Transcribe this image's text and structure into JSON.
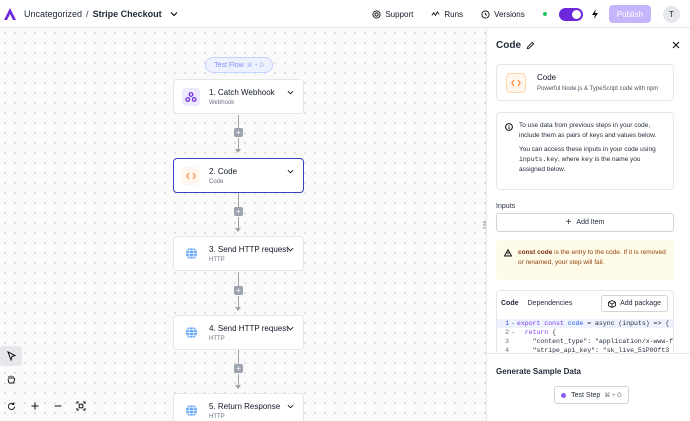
{
  "header": {
    "breadcrumb_folder": "Uncategorized",
    "breadcrumb_sep": "/",
    "flow_name": "Stripe Checkout",
    "support": "Support",
    "runs": "Runs",
    "versions": "Versions",
    "publish": "Publish",
    "avatar_initial": "T",
    "colors": {
      "accent": "#6d28d9",
      "publish_bg": "#c4b5fd",
      "status": "#22c55e"
    }
  },
  "canvas": {
    "test_flow": "Test Flow",
    "test_flow_kbd": "⌘ + D",
    "nodes": [
      {
        "title": "1. Catch Webhook",
        "subtitle": "Webhook",
        "icon": "webhook-icon"
      },
      {
        "title": "2. Code",
        "subtitle": "Code",
        "icon": "code-icon"
      },
      {
        "title": "3. Send HTTP request",
        "subtitle": "HTTP",
        "icon": "globe-icon"
      },
      {
        "title": "4. Send HTTP request",
        "subtitle": "HTTP",
        "icon": "globe-icon"
      },
      {
        "title": "5. Return Response",
        "subtitle": "HTTP",
        "icon": "globe-icon"
      }
    ],
    "add_step": "+"
  },
  "panel": {
    "title": "Code",
    "piece_name": "Code",
    "piece_desc": "Powerful Node.js & TypeScript code with npm",
    "info_p1": "To use data from previous steps in your code, include them as pairs of keys and values below.",
    "info_p2_a": "You can access these inputs in your code using ",
    "info_p2_code1": "inputs.key",
    "info_p2_b": ", where ",
    "info_p2_code2": "key",
    "info_p2_c": " is the name you assigned below.",
    "inputs_label": "Inputs",
    "add_item": "Add Item",
    "warn_bold": "const code",
    "warn_text": " is the entry to the code. If it is removed or renamed, your step will fail.",
    "tab_code": "Code",
    "tab_deps": "Dependencies",
    "add_package": "Add package",
    "code_lines": [
      {
        "ln": "1",
        "text_kw": "export const ",
        "text_fn": "code",
        "text_rest": " = async (inputs) => {"
      },
      {
        "ln": "2",
        "text_kw": "  return ",
        "text_fn": "",
        "text_rest": "{"
      },
      {
        "ln": "3",
        "text_kw": "",
        "text_fn": "",
        "text_rest": "    \"content_type\": \"application/x-www-f"
      },
      {
        "ln": "4",
        "text_kw": "",
        "text_fn": "",
        "text_rest": "    \"stripe_api_key\": \"sk_live_51P0Oft3"
      }
    ],
    "generate_title": "Generate Sample Data",
    "test_step": "Test Step",
    "test_step_kbd": "⌘ + G"
  }
}
